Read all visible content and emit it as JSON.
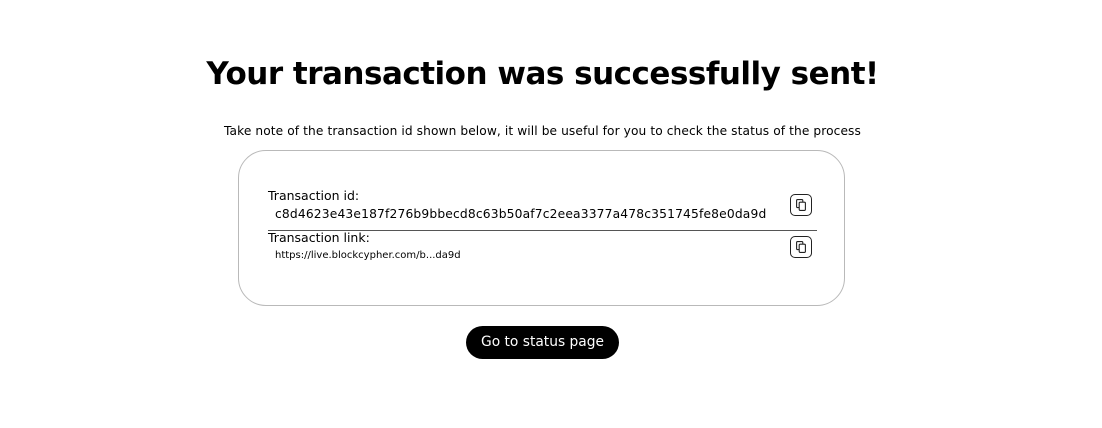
{
  "page": {
    "title": "Your transaction was successfully sent!",
    "subtitle": "Take note of the transaction id shown below, it will be useful for you to check the status of the process"
  },
  "transaction": {
    "id_label": "Transaction id:",
    "id_value": "c8d4623e43e187f276b9bbecd8c63b50af7c2eea3377a478c351745fe8e0da9d",
    "link_label": "Transaction link:",
    "link_value": "https://live.blockcypher.com/b...da9d",
    "copy_icon": "copy-icon"
  },
  "actions": {
    "status_button_label": "Go to status page"
  },
  "colors": {
    "primary": "#000000",
    "on_primary": "#ffffff",
    "card_border": "#b9b9b9",
    "background": "#ffffff"
  }
}
